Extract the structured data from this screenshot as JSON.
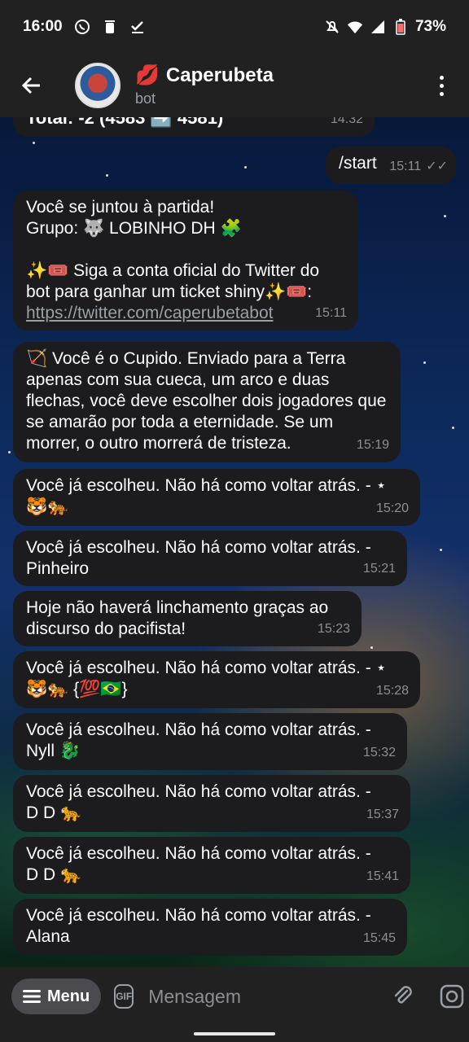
{
  "status_bar": {
    "time": "16:00",
    "battery": "73%"
  },
  "header": {
    "title": "Caperubeta",
    "title_emoji": "💋",
    "subtitle": "bot"
  },
  "messages": [
    {
      "text": "Total: -2 (4583 ➡️ 4581)",
      "time": "14:32"
    },
    {
      "text": "/start",
      "time": "15:11",
      "outgoing": true
    },
    {
      "text": "Você se juntou à partida!\nGrupo: 🐺 LOBINHO DH 🧩\n\n✨🎟️ Siga a conta oficial do Twitter do bot para ganhar um ticket shiny✨🎟️:",
      "link": "https://twitter.com/caperubetabot",
      "time": "15:11"
    },
    {
      "text": "🏹 Você é o Cupido. Enviado para a Terra apenas com sua cueca, um arco e duas flechas, você deve escolher dois jogadores que se amarão por toda a eternidade. Se um morrer, o outro morrerá de tristeza.",
      "time": "15:19"
    },
    {
      "text": "Você já escolheu. Não há como voltar atrás. - ⋆\n🐯🐅",
      "time": "15:20"
    },
    {
      "text": "Você já escolheu. Não há como voltar atrás. -\nPinheiro",
      "time": "15:21"
    },
    {
      "text": "Hoje não haverá linchamento graças ao\ndiscurso do pacifista!",
      "time": "15:23"
    },
    {
      "text": "Você já escolheu. Não há como voltar atrás. - ⋆\n🐯🐅 {💯🇧🇷}",
      "time": "15:28"
    },
    {
      "text": "Você já escolheu. Não há como voltar atrás. -\nNyll 🐉",
      "time": "15:32"
    },
    {
      "text": "Você já escolheu. Não há como voltar atrás. -\nD D 🐆",
      "time": "15:37"
    },
    {
      "text": "Você já escolheu. Não há como voltar atrás. -\nD D 🐆",
      "time": "15:41"
    },
    {
      "text": "Você já escolheu. Não há como voltar atrás. -\nAlana",
      "time": "15:45"
    }
  ],
  "input": {
    "menu_label": "Menu",
    "gif_label": "GIF",
    "placeholder": "Mensagem"
  }
}
